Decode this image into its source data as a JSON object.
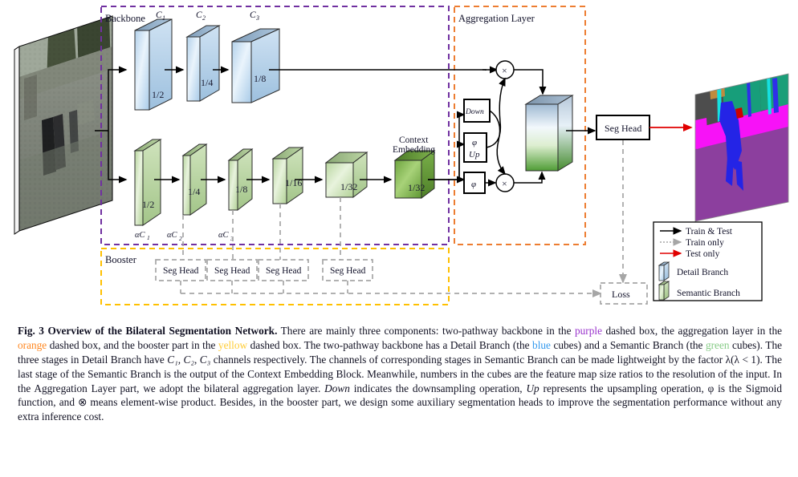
{
  "figure": {
    "regions": [
      {
        "name": "Backbone",
        "label": "Backbone",
        "color": "#7030a0",
        "style": "dashed"
      },
      {
        "name": "Aggregation Layer",
        "label": "Aggregation Layer",
        "color": "#ed7d31",
        "style": "dashed"
      },
      {
        "name": "Booster",
        "label": "Booster",
        "color": "#ffc000",
        "style": "dashed"
      }
    ],
    "detail_branch": {
      "channel_labels": [
        "C1",
        "C2",
        "C3"
      ],
      "cubes": [
        {
          "ratio": "1/2",
          "channel": "C1"
        },
        {
          "ratio": "1/4",
          "channel": "C2"
        },
        {
          "ratio": "1/8",
          "channel": "C3"
        }
      ]
    },
    "semantic_branch": {
      "channel_labels": [
        "αC1",
        "αC2",
        "αC3"
      ],
      "cubes": [
        {
          "ratio": "1/2",
          "channel": "αC1"
        },
        {
          "ratio": "1/4",
          "channel": "αC2"
        },
        {
          "ratio": "1/8",
          "channel": "αC3"
        },
        {
          "ratio": "1/16",
          "channel": ""
        },
        {
          "ratio": "1/32",
          "channel": ""
        },
        {
          "ratio": "1/32",
          "channel": "",
          "label": "Context Embedding"
        }
      ],
      "context_embedding_label_line1": "Context",
      "context_embedding_label_line2": "Embedding"
    },
    "aggregation": {
      "title": "Aggregation Layer",
      "blocks": [
        {
          "id": "down",
          "label": "Down"
        },
        {
          "id": "phi-up",
          "label_line1": "φ",
          "label_line2": "Up"
        },
        {
          "id": "phi",
          "label": "φ"
        }
      ],
      "operators": [
        {
          "id": "mul-top",
          "symbol": "×"
        },
        {
          "id": "mul-bottom",
          "symbol": "×"
        }
      ]
    },
    "seg_head_main": "Seg Head",
    "booster": {
      "title": "Booster",
      "seg_heads": [
        "Seg Head",
        "Seg Head",
        "Seg Head",
        "Seg Head"
      ]
    },
    "loss": "Loss",
    "legend": {
      "items": [
        {
          "kind": "arrow-solid-black",
          "label": "Train & Test",
          "color": "#000000"
        },
        {
          "kind": "arrow-dotted-gray",
          "label": "Train only",
          "color": "#a6a6a6"
        },
        {
          "kind": "arrow-solid-red",
          "label": "Test only",
          "color": "#e00000"
        },
        {
          "kind": "cube-blue",
          "label": "Detail Branch",
          "color": "#b8d4ee"
        },
        {
          "kind": "cube-green",
          "label": "Semantic Branch",
          "color": "#bcd9a4"
        }
      ]
    },
    "input_image": "street-scene-photo",
    "output_image": "semantic-segmentation-map"
  },
  "caption": {
    "fig_label": "Fig. 3",
    "title": "Overview of the Bilateral Segmentation Network.",
    "segments": [
      {
        "t": " There are mainly three components: two-pathway backbone in the "
      },
      {
        "t": "purple",
        "c": "purple"
      },
      {
        "t": " dashed box, the aggregation layer in the "
      },
      {
        "t": "orange",
        "c": "orange"
      },
      {
        "t": " dashed box, and the booster part in the "
      },
      {
        "t": "yellow",
        "c": "yellow"
      },
      {
        "t": " dashed box. The two-pathway backbone has a Detail Branch (the "
      },
      {
        "t": "blue",
        "c": "blue"
      },
      {
        "t": " cubes) and a Semantic Branch (the "
      },
      {
        "t": "green",
        "c": "green"
      },
      {
        "t": " cubes). The three stages in Detail Branch have "
      },
      {
        "t": "C₁, C₂, C₃",
        "c": "italic"
      },
      {
        "t": " channels respectively. The channels of corresponding stages in Semantic Branch can be made lightweight by the factor λ(λ < 1). The last stage of the Semantic Branch is the output of the Context Embedding Block. Meanwhile, numbers in the cubes are the feature map size ratios to the resolution of the input. In the Aggregation Layer part, we adopt the bilateral aggregation layer. "
      },
      {
        "t": "Down",
        "c": "italic"
      },
      {
        "t": " indicates the downsampling operation, "
      },
      {
        "t": "Up",
        "c": "italic"
      },
      {
        "t": " represents the upsampling operation, φ is the Sigmoid function, and ⊗ means element-wise product. Besides, in the booster part, we design some auxiliary segmentation heads to improve the segmentation performance without any extra inference cost."
      }
    ]
  }
}
